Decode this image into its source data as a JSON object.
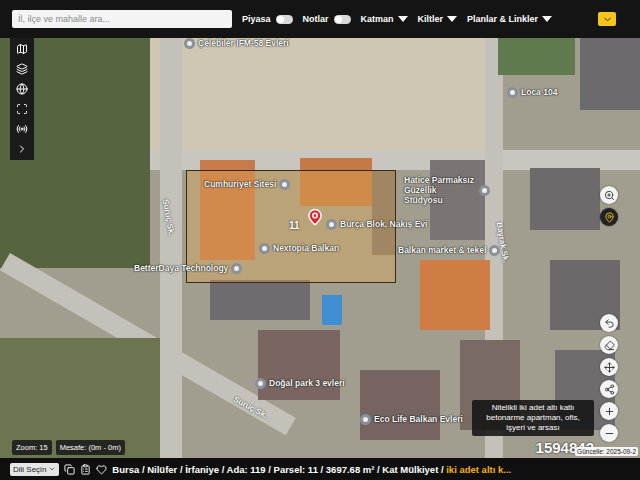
{
  "search": {
    "placeholder": "İl, ilçe ve mahalle ara..."
  },
  "toggles": [
    {
      "label": "Piyasa",
      "on": false
    },
    {
      "label": "Notlar",
      "on": false
    }
  ],
  "menus": [
    {
      "label": "Katman"
    },
    {
      "label": "Kiltler"
    },
    {
      "label": "Planlar & Linkler"
    }
  ],
  "map": {
    "places": [
      "Çelebiler IFM-58 Evleri",
      "Loca 104",
      "Cumhuriyet Sitesi",
      "Nextopia Balkan",
      "Burça Blok, Nakış Evi",
      "Hatice Parmaksız Güzellik Stüdyosu",
      "Balkan market & tekel",
      "BetterDaya Technology",
      "Doğal park 3 evleri",
      "Eco Life Balkan Evleri"
    ],
    "streets": [
      "Suruç Sk.",
      "Bayrak Sk.",
      "Suruç Sk."
    ],
    "parcel": {
      "number": "11"
    }
  },
  "zoom": "Zoom: 15",
  "distance": "Mesafe: (0m - 0m)",
  "tooltip": "Nitelikli iki adet altı katlı betonarme apartman, ofis, işyeri ve arsası",
  "watermark": "1594842",
  "updated": "Güncelle: 2025-09-2",
  "status_bar": {
    "language": "Dili Seçin",
    "location": "Bursa / Nilüfer / İrfaniye / Ada: 119 / Parsel: 11 / 3697.68 m² / Kat Mülkiyet /",
    "highlight": "iki adet altı k..."
  }
}
